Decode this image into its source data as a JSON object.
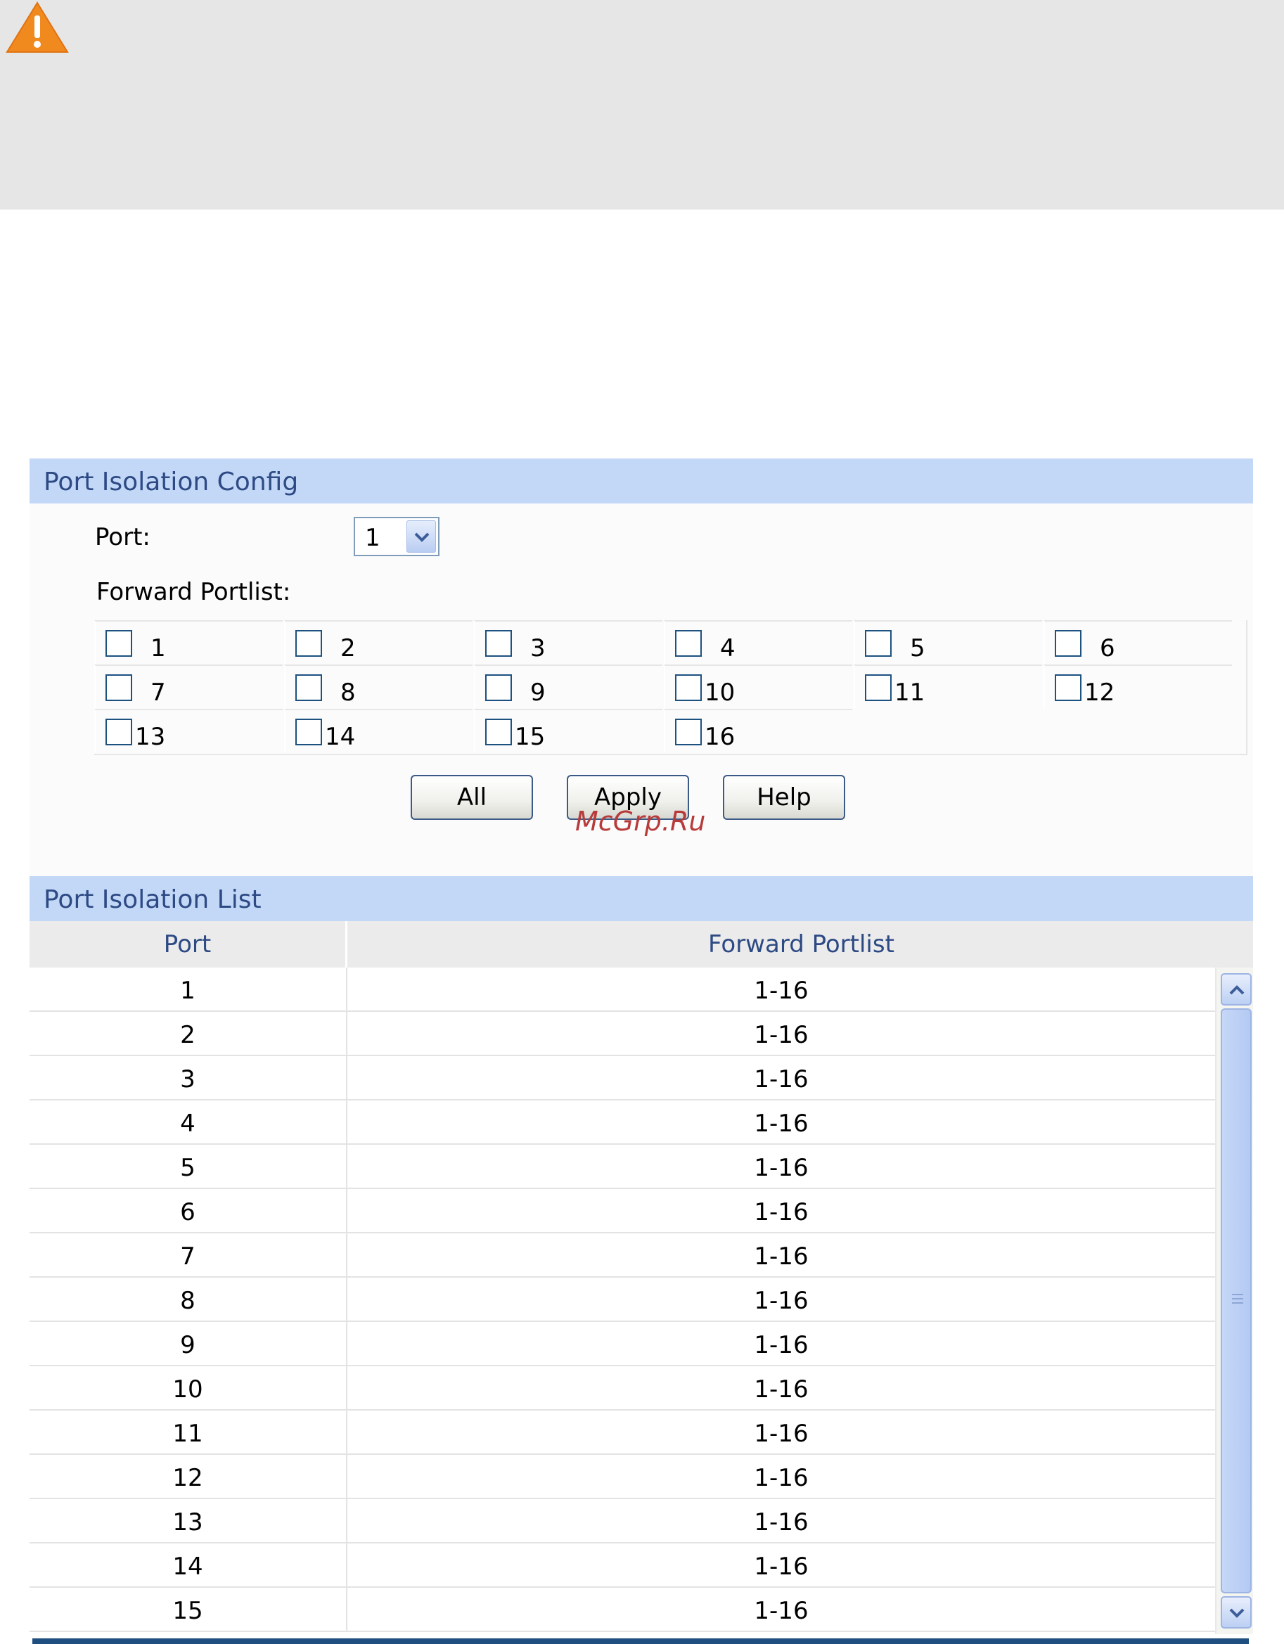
{
  "config": {
    "title": "Port Isolation Config",
    "port_label": "Port:",
    "port_value": "1",
    "forward_label": "Forward Portlist:",
    "ports": [
      "1",
      "2",
      "3",
      "4",
      "5",
      "6",
      "7",
      "8",
      "9",
      "10",
      "11",
      "12",
      "13",
      "14",
      "15",
      "16"
    ],
    "buttons": {
      "all": "All",
      "apply": "Apply",
      "help": "Help"
    }
  },
  "watermark": "McGrp.Ru",
  "list": {
    "title": "Port Isolation List",
    "columns": [
      "Port",
      "Forward Portlist"
    ],
    "rows": [
      {
        "port": "1",
        "fwd": "1-16"
      },
      {
        "port": "2",
        "fwd": "1-16"
      },
      {
        "port": "3",
        "fwd": "1-16"
      },
      {
        "port": "4",
        "fwd": "1-16"
      },
      {
        "port": "5",
        "fwd": "1-16"
      },
      {
        "port": "6",
        "fwd": "1-16"
      },
      {
        "port": "7",
        "fwd": "1-16"
      },
      {
        "port": "8",
        "fwd": "1-16"
      },
      {
        "port": "9",
        "fwd": "1-16"
      },
      {
        "port": "10",
        "fwd": "1-16"
      },
      {
        "port": "11",
        "fwd": "1-16"
      },
      {
        "port": "12",
        "fwd": "1-16"
      },
      {
        "port": "13",
        "fwd": "1-16"
      },
      {
        "port": "14",
        "fwd": "1-16"
      },
      {
        "port": "15",
        "fwd": "1-16"
      }
    ]
  },
  "colors": {
    "panel_header_bg": "#c3d8f7",
    "panel_header_text": "#2d4a84",
    "warning_orange": "#f08a1f",
    "note_bg": "#e6e6e6"
  }
}
